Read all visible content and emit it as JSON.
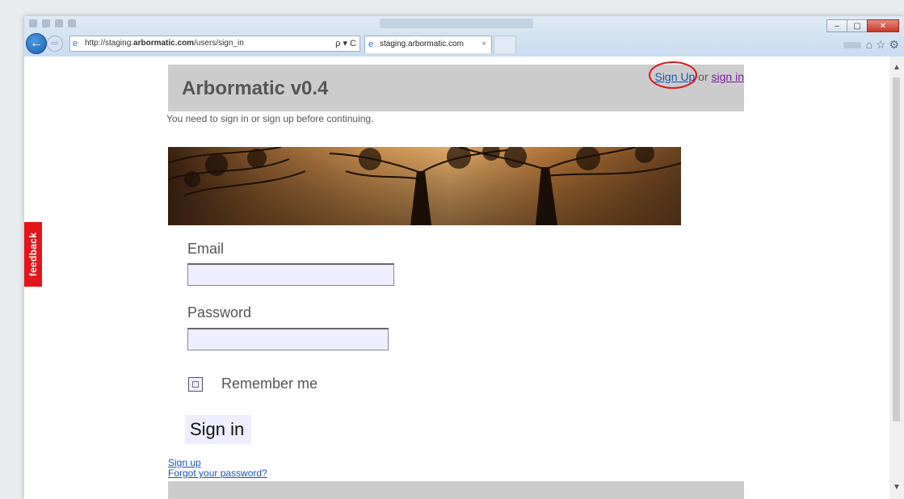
{
  "browser": {
    "url_prefix": "http://staging.",
    "url_host": "arbormatic.com",
    "url_path": "/users/sign_in",
    "address_controls": "ρ ▾ C",
    "tab_title": "staging.arbormatic.com",
    "tab_close": "×",
    "back_glyph": "←",
    "forward_glyph": "⇨",
    "win_min": "–",
    "win_max": "▢",
    "win_close": "✕",
    "tools": "⌂ ☆ ⚙"
  },
  "feedback": {
    "label": "feedback"
  },
  "header": {
    "title": "Arbormatic v0.4",
    "signup_link": "Sign Up",
    "or_text": " or ",
    "signin_link": "sign in"
  },
  "notice": "You need to sign in or sign up before continuing.",
  "form": {
    "email_label": "Email",
    "email_value": "",
    "password_label": "Password",
    "password_value": "",
    "remember_label": "Remember me",
    "submit_label": "Sign in"
  },
  "links": {
    "sign_up": "Sign up",
    "forgot": "Forgot your password?"
  },
  "colors": {
    "header_bg": "#cccccc",
    "link": "#1a55b0",
    "visited_link": "#7a1fa0",
    "feedback_bg": "#e3151b",
    "highlight": "#e0101a",
    "input_bg": "#eeeefe"
  }
}
